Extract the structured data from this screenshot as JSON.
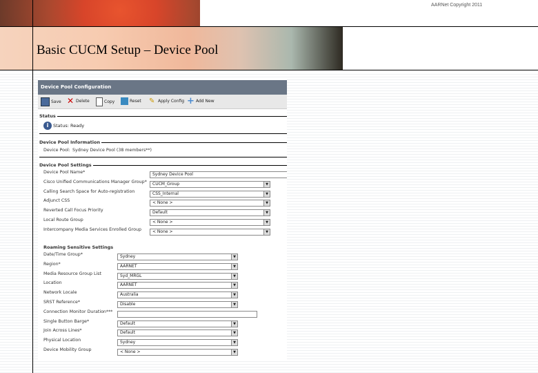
{
  "slide": {
    "copyright": "AARNet Copyright 2011",
    "title": "Basic CUCM Setup – Device Pool"
  },
  "panel": {
    "header": "Device Pool Configuration",
    "toolbar": {
      "save": "Save",
      "delete": "Delete",
      "copy": "Copy",
      "reset": "Reset",
      "apply": "Apply Config",
      "add": "Add New"
    },
    "status": {
      "legend": "Status",
      "text": "Status: Ready"
    },
    "info": {
      "legend": "Device Pool Information",
      "label": "Device Pool:",
      "value": "Sydney Device Pool  (38 members**)"
    },
    "settings": {
      "legend": "Device Pool Settings",
      "fields": [
        {
          "label": "Device Pool Name*",
          "value": "Sydney Device Pool"
        },
        {
          "label": "Cisco Unified Communications Manager Group*",
          "value": "CUCM_Group"
        },
        {
          "label": "Calling Search Space for Auto-registration",
          "value": "CSS_Internal"
        },
        {
          "label": "Adjunct CSS",
          "value": "< None >"
        },
        {
          "label": "Reverted Call Focus Priority",
          "value": "Default"
        },
        {
          "label": "Local Route Group",
          "value": "< None >"
        },
        {
          "label": "Intercompany Media Services Enrolled Group",
          "value": "< None >"
        }
      ]
    },
    "roaming": {
      "heading": "Roaming Sensitive Settings",
      "fields": [
        {
          "label": "Date/Time Group*",
          "value": "Sydney"
        },
        {
          "label": "Region*",
          "value": "AARNET"
        },
        {
          "label": "Media Resource Group List",
          "value": "Syd_MRGL"
        },
        {
          "label": "Location",
          "value": "AARNET"
        },
        {
          "label": "Network Locale",
          "value": "Australia"
        },
        {
          "label": "SRST Reference*",
          "value": "Disable"
        },
        {
          "label": "Connection Monitor Duration***",
          "value": ""
        },
        {
          "label": "Single Button Barge*",
          "value": "Default"
        },
        {
          "label": "Join Across Lines*",
          "value": "Default"
        },
        {
          "label": "Physical Location",
          "value": "Sydney"
        },
        {
          "label": "Device Mobility Group",
          "value": "< None >"
        }
      ]
    }
  }
}
